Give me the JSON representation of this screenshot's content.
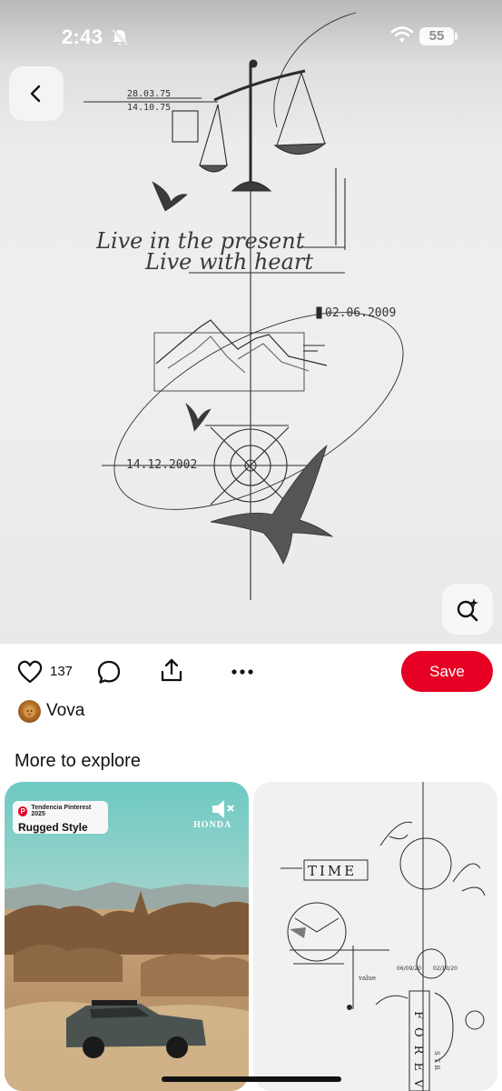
{
  "status_bar": {
    "time": "2:43",
    "battery": "55",
    "icons": [
      "bell-slash-icon",
      "wifi-icon",
      "battery-icon"
    ]
  },
  "pin": {
    "image_texts": {
      "date_1": "28.03.75",
      "date_2": "14.10.75",
      "date_3": "02.06.2009",
      "date_4": "14.12.2002",
      "script_line_1": "Live in the present",
      "script_line_2": "Live with heart"
    },
    "back_icon": "chevron-left-icon",
    "lens_icon": "visual-search-icon"
  },
  "actions": {
    "like_icon": "heart-icon",
    "like_count": "137",
    "comment_icon": "comment-icon",
    "share_icon": "share-icon",
    "more_icon": "more-icon",
    "save_label": "Save",
    "accent_color": "#e60023"
  },
  "creator": {
    "name": "Vova"
  },
  "explore": {
    "title": "More to explore",
    "cards": [
      {
        "badge_sub": "Tendencia Pinterest 2025",
        "badge_title": "Rugged Style",
        "brand": "HONDA"
      },
      {
        "texts": {
          "time": "TIME",
          "forever": "FOREVE",
          "date_a": "06/09/20",
          "date_b": "02/10/20",
          "value": "value",
          "str": "STR"
        }
      }
    ]
  }
}
